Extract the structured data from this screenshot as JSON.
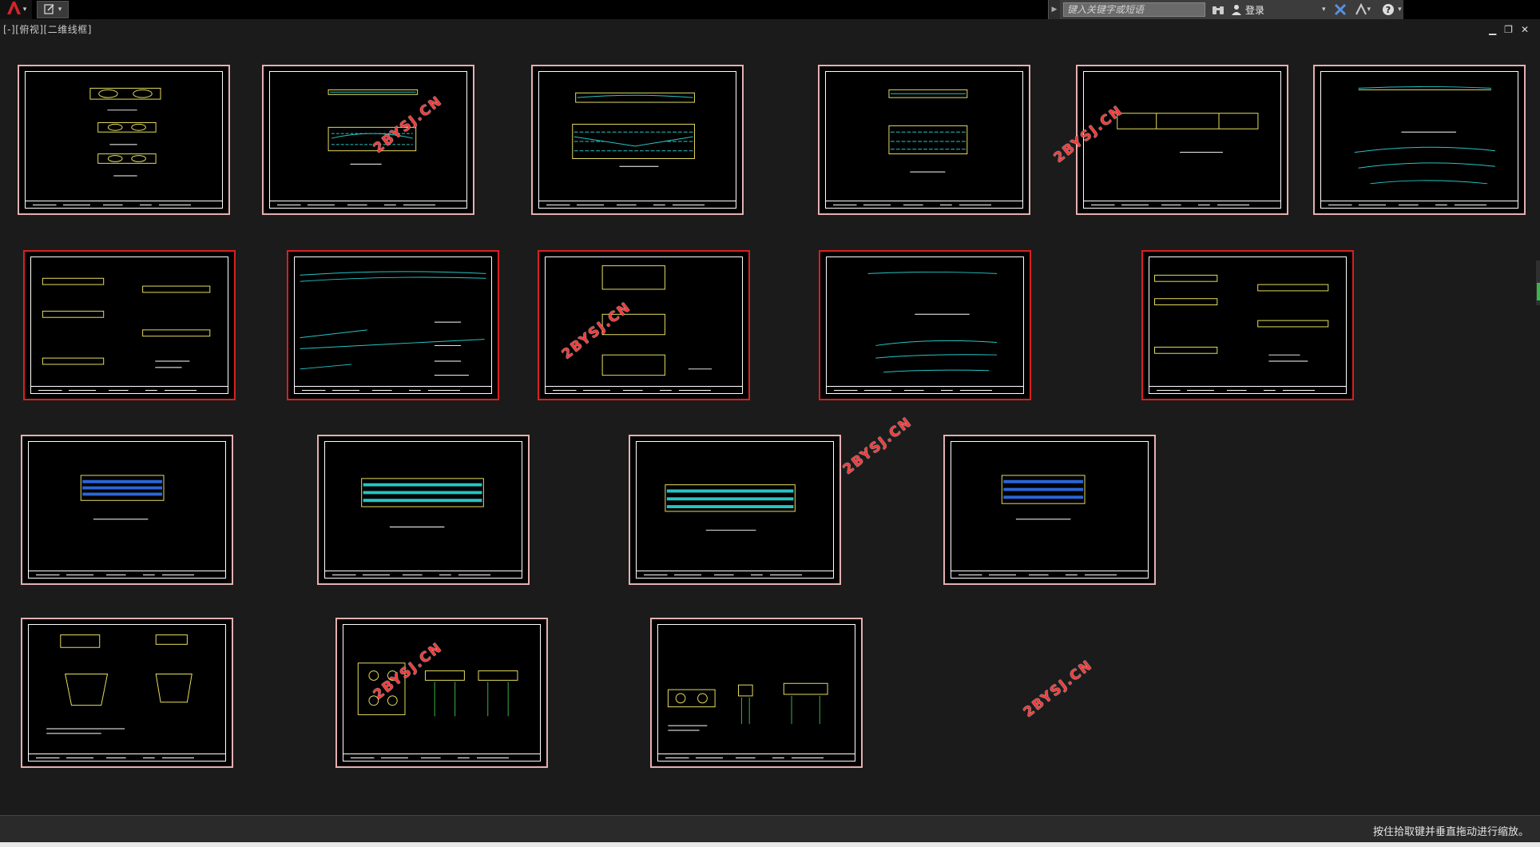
{
  "toolbar": {
    "app_icon": "autocad-a-icon",
    "quick_access_icon": "document-edit-icon",
    "search_placeholder": "键入关键字或短语",
    "login_label": "登录"
  },
  "viewport": {
    "label": "[-][俯视][二维线框]"
  },
  "watermarks": [
    "2BYSJ.CN",
    "2BYSJ.CN",
    "2BYSJ.CN",
    "2BYSJ.CN",
    "2BYSJ.CN",
    "2BYSJ.CN"
  ],
  "sheets": [
    {
      "name": "sheet-1",
      "selected": false
    },
    {
      "name": "sheet-2",
      "selected": false
    },
    {
      "name": "sheet-3",
      "selected": false
    },
    {
      "name": "sheet-4",
      "selected": false
    },
    {
      "name": "sheet-5",
      "selected": false
    },
    {
      "name": "sheet-6",
      "selected": false
    },
    {
      "name": "sheet-7",
      "selected": true
    },
    {
      "name": "sheet-8",
      "selected": true
    },
    {
      "name": "sheet-9",
      "selected": true
    },
    {
      "name": "sheet-10",
      "selected": true
    },
    {
      "name": "sheet-11",
      "selected": true
    },
    {
      "name": "sheet-12",
      "selected": false
    },
    {
      "name": "sheet-13",
      "selected": false
    },
    {
      "name": "sheet-14",
      "selected": false
    },
    {
      "name": "sheet-15",
      "selected": false
    },
    {
      "name": "sheet-16",
      "selected": false
    },
    {
      "name": "sheet-17",
      "selected": false
    },
    {
      "name": "sheet-18",
      "selected": false
    }
  ],
  "status": {
    "message": "按住拾取键并垂直拖动进行缩放。"
  }
}
